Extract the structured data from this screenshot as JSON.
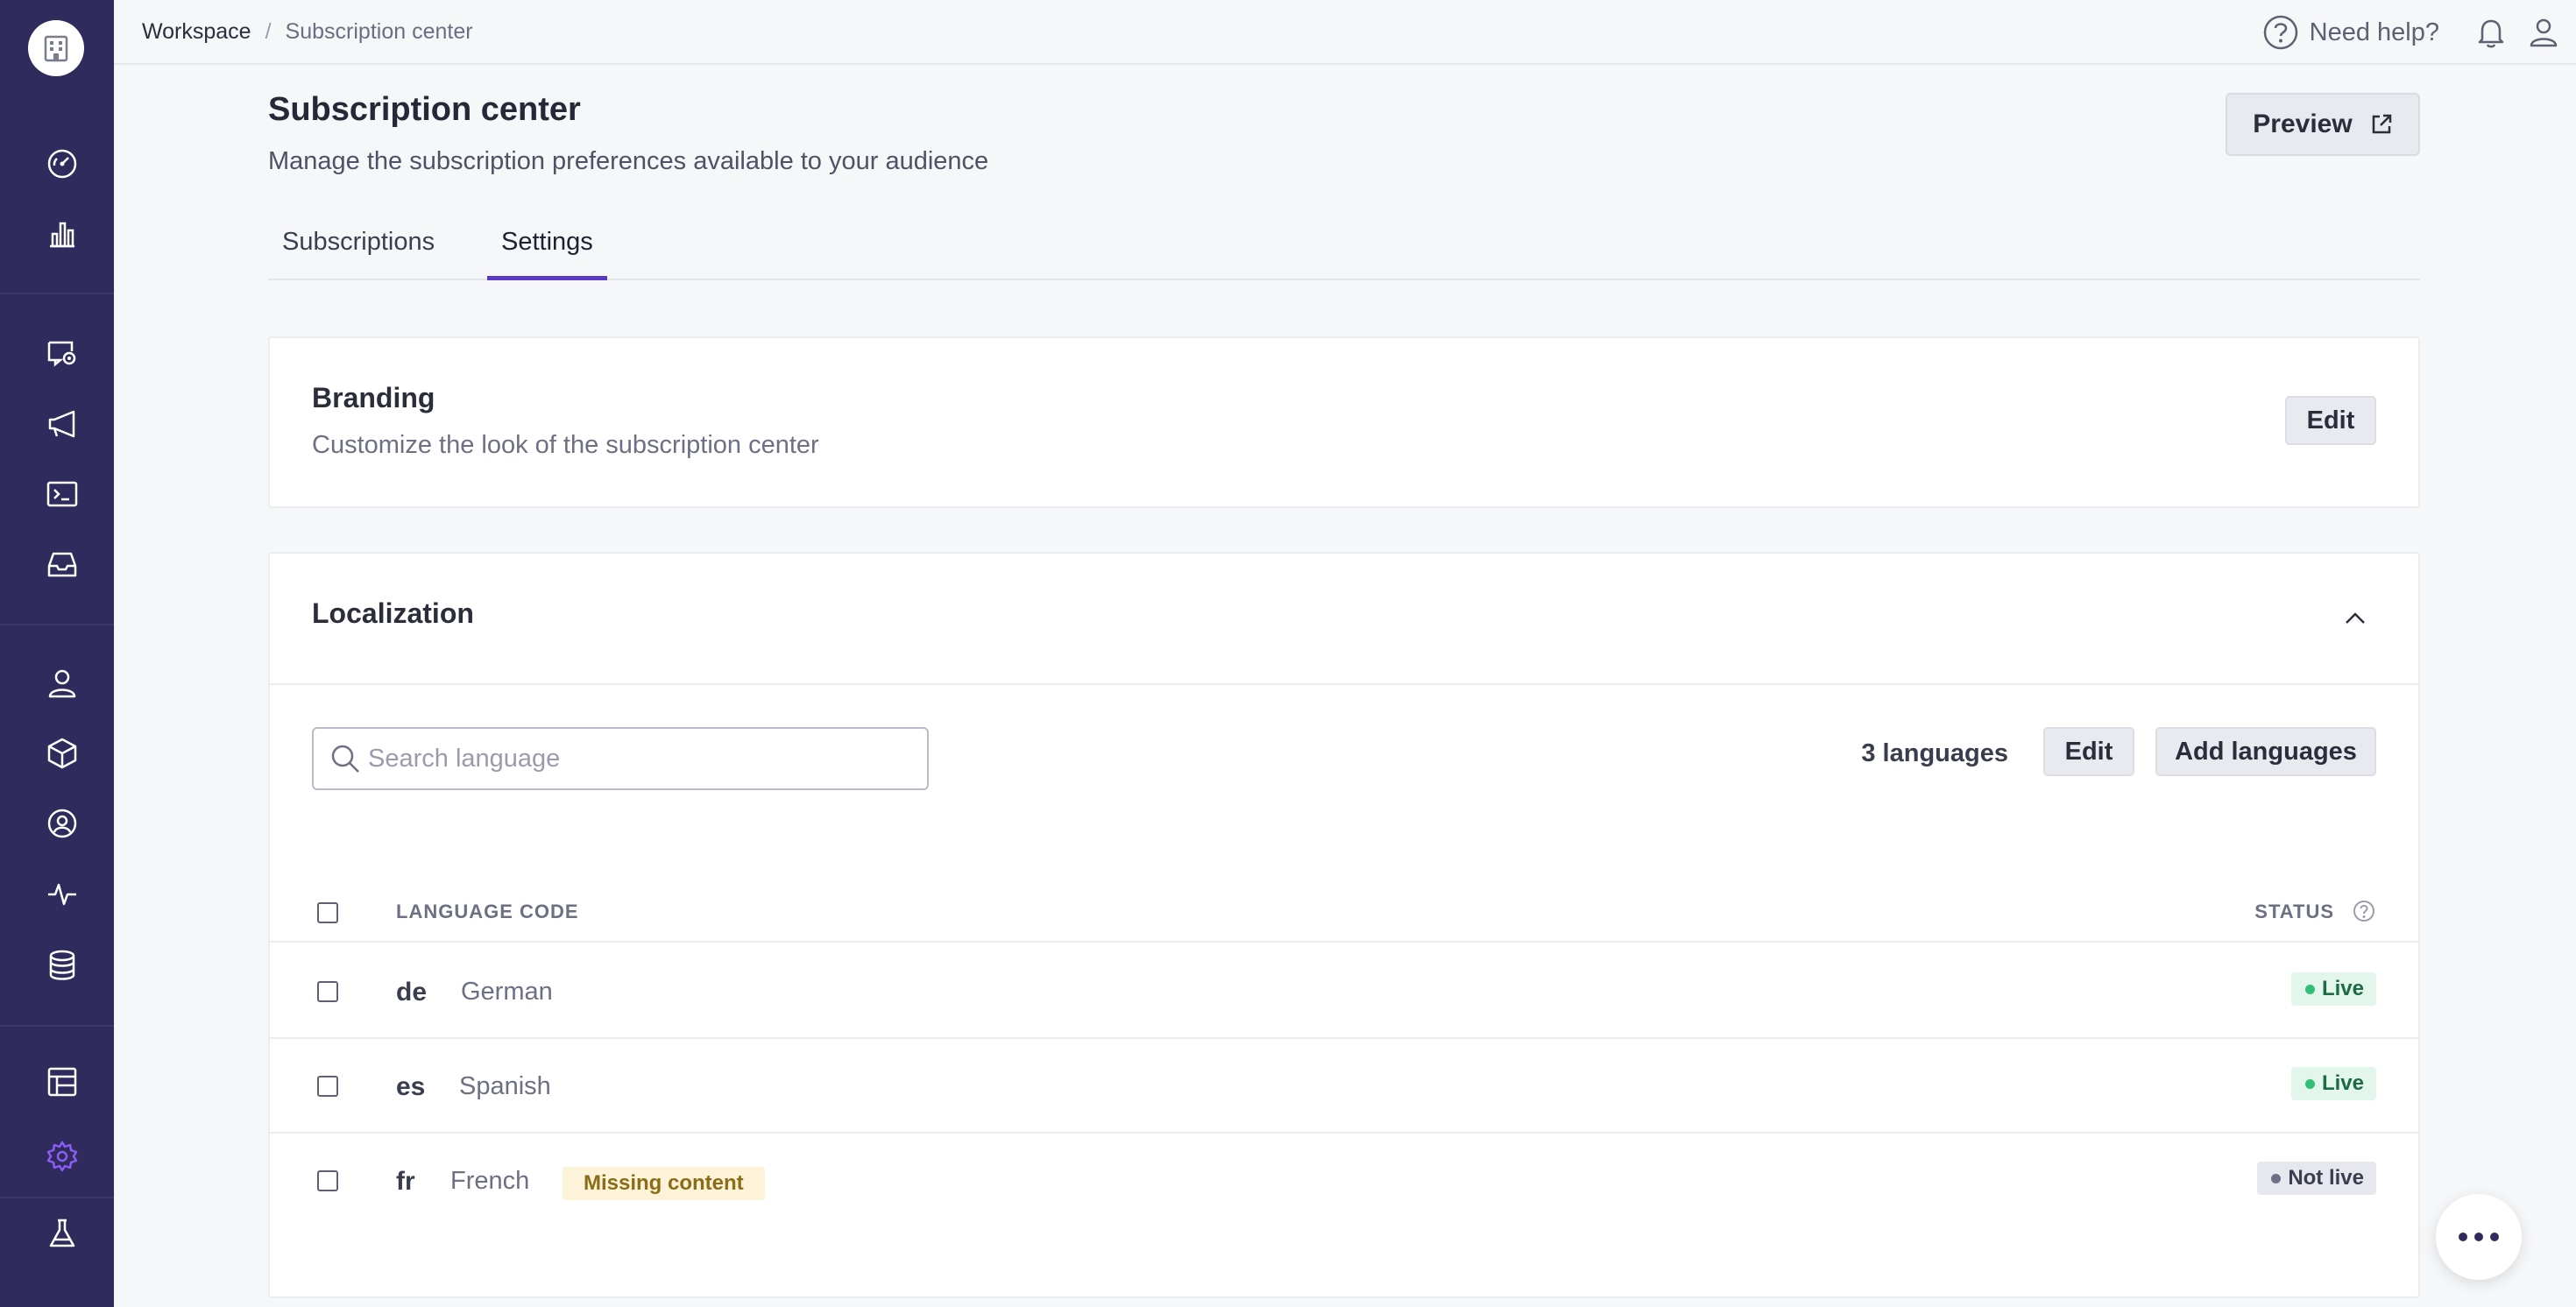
{
  "breadcrumb": {
    "root": "Workspace",
    "separator": "/",
    "current": "Subscription center"
  },
  "topbar": {
    "help_label": "Need help?"
  },
  "sidebar": {
    "items": [
      {
        "icon": "dashboard-icon"
      },
      {
        "icon": "bar-chart-icon"
      },
      {
        "icon": "campaign-icon"
      },
      {
        "icon": "megaphone-icon"
      },
      {
        "icon": "terminal-icon"
      },
      {
        "icon": "inbox-icon"
      },
      {
        "icon": "person-icon"
      },
      {
        "icon": "cube-icon"
      },
      {
        "icon": "user-circle-icon"
      },
      {
        "icon": "activity-icon"
      },
      {
        "icon": "database-icon"
      },
      {
        "icon": "layout-icon"
      },
      {
        "icon": "gear-icon",
        "active": true
      },
      {
        "icon": "flask-icon"
      }
    ],
    "active_color": "#8b5cf6"
  },
  "page": {
    "title": "Subscription center",
    "subtitle": "Manage the subscription preferences available to your audience",
    "preview_label": "Preview"
  },
  "tabs": [
    {
      "label": "Subscriptions",
      "active": false
    },
    {
      "label": "Settings",
      "active": true
    }
  ],
  "branding": {
    "title": "Branding",
    "description": "Customize the look of the subscription center",
    "edit_label": "Edit"
  },
  "localization": {
    "title": "Localization",
    "search_placeholder": "Search language",
    "count_label": "3 languages",
    "edit_label": "Edit",
    "add_label": "Add languages",
    "columns": {
      "code": "LANGUAGE CODE",
      "status": "STATUS"
    },
    "rows": [
      {
        "code": "de",
        "name": "German",
        "badge": "",
        "status": "Live"
      },
      {
        "code": "es",
        "name": "Spanish",
        "badge": "",
        "status": "Live"
      },
      {
        "code": "fr",
        "name": "French",
        "badge": "Missing content",
        "status": "Not live"
      }
    ]
  },
  "colors": {
    "sidebar": "#2f2b5c",
    "accent": "#5d38c6",
    "live": "#2fbf75",
    "warning": "#fdf3d9"
  }
}
